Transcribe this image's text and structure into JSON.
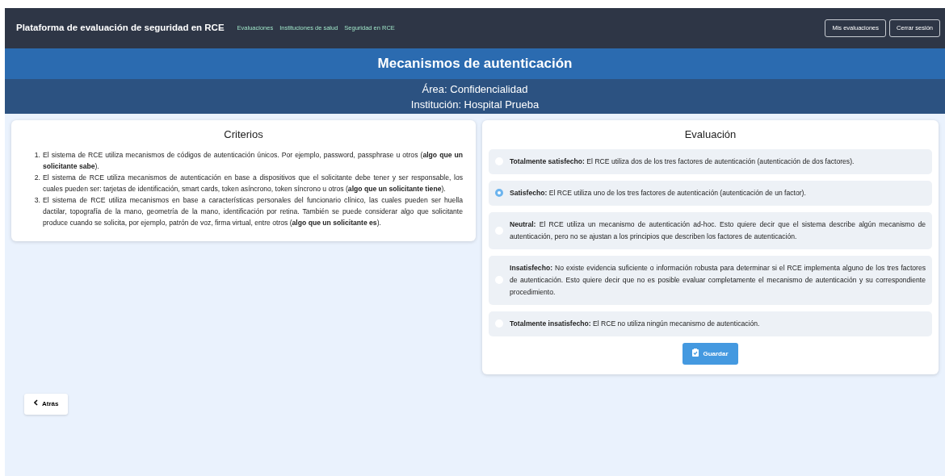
{
  "navbar": {
    "brand": "Plataforma de evaluación de seguridad en RCE",
    "links": [
      "Evaluaciones",
      "Instituciones de salud",
      "Seguridad en RCE"
    ],
    "buttons": [
      "Mis evaluaciones",
      "Cerrar sesión"
    ]
  },
  "header": {
    "title": "Mecanismos de autenticación",
    "area": "Área: Confidencialidad",
    "institution": "Institución: Hospital Prueba"
  },
  "criteria": {
    "title": "Criterios",
    "items": [
      {
        "number": "1.",
        "text": "El sistema de RCE utiliza mecanismos de códigos de autenticación únicos. Por ejemplo, password, passphrase u otros (**algo que un solicitante sabe**)."
      },
      {
        "number": "2.",
        "text": "El sistema de RCE utiliza mecanismos de autenticación en base a dispositivos que el solicitante debe tener y ser responsable, los cuales pueden ser: tarjetas de identificación, smart cards, token asíncrono, token síncrono u otros (**algo que un solicitante tiene**)."
      },
      {
        "number": "3.",
        "text": "El sistema de RCE utiliza mecanismos en base a características personales del funcionario clínico, las cuales pueden ser huella dactilar, topografía de la mano, geometría de la mano, identificación por retina. También se puede considerar algo que solicitante produce cuando se solicita, por ejemplo, patrón de voz, firma virtual, entre otros (**algo que un solicitante es**)."
      }
    ]
  },
  "evaluation": {
    "title": "Evaluación",
    "options": [
      {
        "text": "**Totalmente satisfecho:** El RCE utiliza dos de los tres factores de autenticación (autenticación de dos factores).",
        "selected": false
      },
      {
        "text": "**Satisfecho:** El RCE utiliza uno de los tres factores de autenticación (autenticación de un factor).",
        "selected": true
      },
      {
        "text": "**Neutral:** El RCE utiliza un mecanismo de autenticación ad-hoc. Esto quiere decir que el sistema describe algún mecanismo de autenticación, pero no se ajustan a los principios que describen los factores de autenticación.",
        "selected": false
      },
      {
        "text": "**Insatisfecho:** No existe evidencia suficiente o información robusta para determinar si el RCE implementa alguno de los tres factores de autenticación. Esto quiere decir que no es posible evaluar completamente el mecanismo de autenticación y su correspondiente procedimiento.",
        "selected": false
      },
      {
        "text": "**Totalmente insatisfecho:** El RCE no utiliza ningún mecanismo de autenticación.",
        "selected": false
      }
    ],
    "save_button": "Guardar"
  },
  "back_button": "Atrás"
}
